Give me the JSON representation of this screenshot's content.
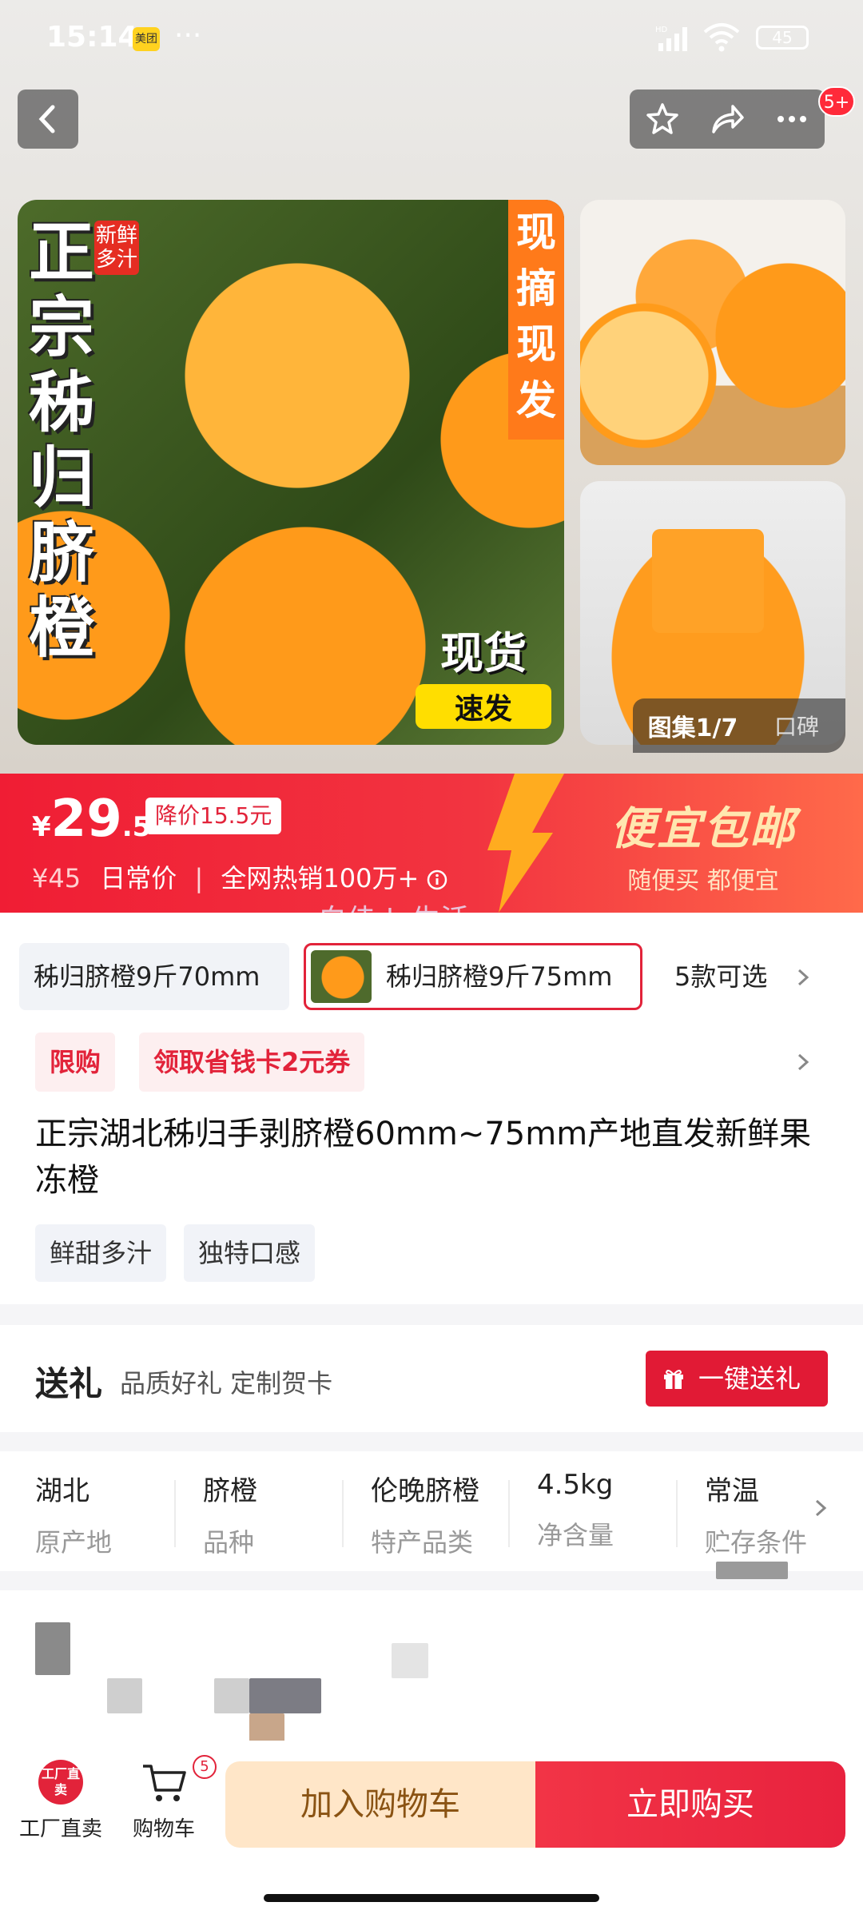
{
  "status": {
    "time": "15:14",
    "app_badge": "美团",
    "more": "···",
    "battery": "45",
    "network": "HD"
  },
  "header": {
    "notification_count": "5+"
  },
  "gallery": {
    "main_vertical_text": "正宗秭归脐橙",
    "fresh_tag": "新鲜多汁",
    "picked_banner": "现摘现发",
    "stock_top": "现货",
    "stock_bottom": "速发",
    "counter": "图集1/7",
    "reviews_tab": "口碑"
  },
  "price": {
    "currency": "¥",
    "integer": "29",
    "decimal": ".5",
    "drop_badge": "降价15.5元",
    "original": "¥45",
    "daily_label": "日常价",
    "hot_sales": "全网热销100万+",
    "promo_title": "便宜包邮",
    "promo_sub": "随便买 都便宜",
    "watermark": "白佳de生活"
  },
  "variants": {
    "option1": "秭归脐橙9斤70mm",
    "option2": "秭归脐橙9斤75mm",
    "more": "5款可选"
  },
  "coupons": {
    "limit": "限购",
    "voucher": "领取省钱卡2元券"
  },
  "product": {
    "title": "正宗湖北秭归手剥脐橙60mm~75mm产地直发新鲜果冻橙",
    "tags": [
      "鲜甜多汁",
      "独特口感"
    ]
  },
  "gift": {
    "title": "送礼",
    "subtitle": "品质好礼 定制贺卡",
    "button": "一键送礼"
  },
  "attributes": [
    {
      "value": "湖北",
      "key": "原产地"
    },
    {
      "value": "脐橙",
      "key": "品种"
    },
    {
      "value": "伦晚脐橙",
      "key": "特产品类"
    },
    {
      "value": "4.5kg",
      "key": "净含量"
    },
    {
      "value": "常温",
      "key": "贮存条件"
    }
  ],
  "bottombar": {
    "factory_logo": "工厂直卖",
    "factory_label": "工厂直卖",
    "cart_label": "购物车",
    "cart_count": "5",
    "add_to_cart": "加入购物车",
    "buy_now": "立即购买"
  }
}
